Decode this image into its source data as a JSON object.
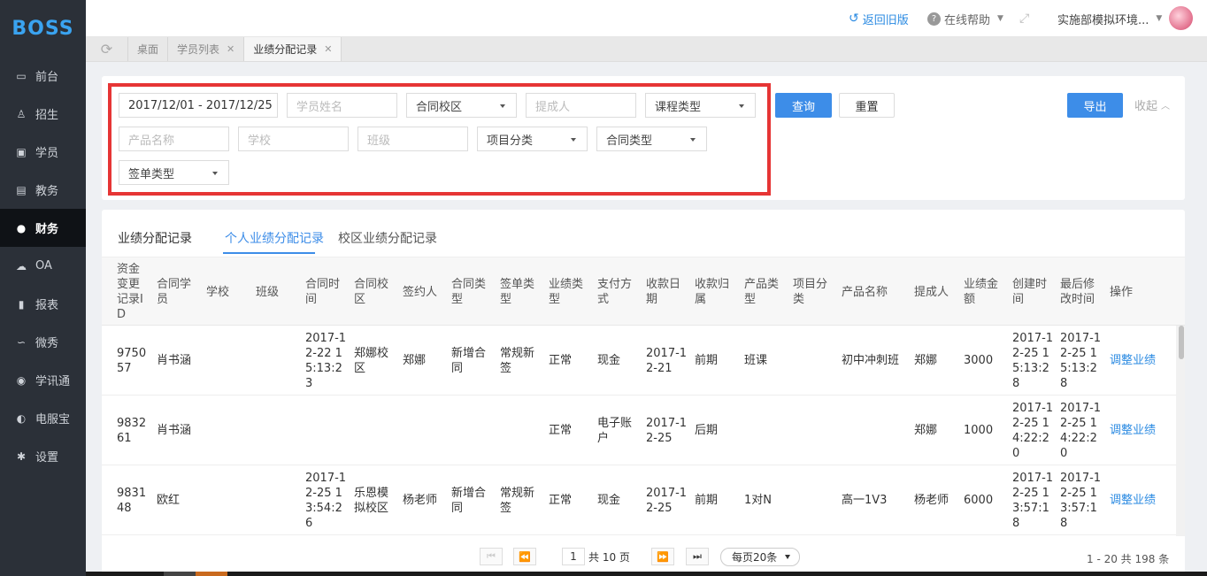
{
  "brand": {
    "logo": "BOSS"
  },
  "sidebar": {
    "items": [
      {
        "label": "前台",
        "icon": "calendar-icon"
      },
      {
        "label": "招生",
        "icon": "user-plus-icon"
      },
      {
        "label": "学员",
        "icon": "id-card-icon"
      },
      {
        "label": "教务",
        "icon": "book-icon"
      },
      {
        "label": "财务",
        "icon": "coin-icon",
        "active": true
      },
      {
        "label": "OA",
        "icon": "cloud-icon"
      },
      {
        "label": "报表",
        "icon": "bar-chart-icon"
      },
      {
        "label": "微秀",
        "icon": "show-icon"
      },
      {
        "label": "学讯通",
        "icon": "location-icon"
      },
      {
        "label": "电服宝",
        "icon": "phone-icon"
      },
      {
        "label": "设置",
        "icon": "gear-icon"
      }
    ]
  },
  "topbar": {
    "back_old": "返回旧版",
    "help": "在线帮助",
    "user": "实施部模拟环境..."
  },
  "tabs": [
    {
      "label": "桌面",
      "closable": false
    },
    {
      "label": "学员列表",
      "closable": true
    },
    {
      "label": "业绩分配记录",
      "closable": true,
      "active": true
    }
  ],
  "filters": {
    "date_range": "2017/12/01 - 2017/12/25",
    "student_name_placeholder": "学员姓名",
    "contract_campus": "合同校区",
    "proposer_placeholder": "提成人",
    "course_type": "课程类型",
    "product_name_placeholder": "产品名称",
    "school_placeholder": "学校",
    "class_placeholder": "班级",
    "project_category": "项目分类",
    "contract_type": "合同类型",
    "sign_type": "签单类型",
    "query_label": "查询",
    "reset_label": "重置",
    "export_label": "导出",
    "collapse_label": "收起"
  },
  "main": {
    "section_title": "业绩分配记录",
    "subtabs": [
      "个人业绩分配记录",
      "校区业绩分配记录"
    ],
    "active_subtab": 0
  },
  "table": {
    "headers": [
      "资金变更记录ID",
      "合同学员",
      "学校",
      "班级",
      "合同时间",
      "合同校区",
      "签约人",
      "合同类型",
      "签单类型",
      "业绩类型",
      "支付方式",
      "收款日期",
      "收款归属",
      "产品类型",
      "项目分类",
      "产品名称",
      "提成人",
      "业绩金额",
      "创建时间",
      "最后修改时间",
      "操作"
    ],
    "rows": [
      [
        "975057",
        "肖书涵",
        "",
        "",
        "2017-12-22 15:13:23",
        "郑娜校区",
        "郑娜",
        "新增合同",
        "常规新签",
        "正常",
        "现金",
        "2017-12-21",
        "前期",
        "班课",
        "",
        "初中冲刺班",
        "郑娜",
        "3000",
        "2017-12-25 15:13:28",
        "2017-12-25 15:13:28",
        "调整业绩"
      ],
      [
        "983261",
        "肖书涵",
        "",
        "",
        "",
        "",
        "",
        "",
        "",
        "正常",
        "电子账户",
        "2017-12-25",
        "后期",
        "",
        "",
        "",
        "郑娜",
        "1000",
        "2017-12-25 14:22:20",
        "2017-12-25 14:22:20",
        "调整业绩"
      ],
      [
        "983148",
        "欧红",
        "",
        "",
        "2017-12-25 13:54:26",
        "乐恩模拟校区",
        "杨老师",
        "新增合同",
        "常规新签",
        "正常",
        "现金",
        "2017-12-25",
        "前期",
        "1对N",
        "",
        "高一1V3",
        "杨老师",
        "6000",
        "2017-12-25 13:57:18",
        "2017-12-25 13:57:18",
        "调整业绩"
      ]
    ]
  },
  "pagination": {
    "current_page": "1",
    "total_pages": "共 10 页",
    "page_size": "每页20条",
    "range": "1 - 20   共 198 条"
  }
}
